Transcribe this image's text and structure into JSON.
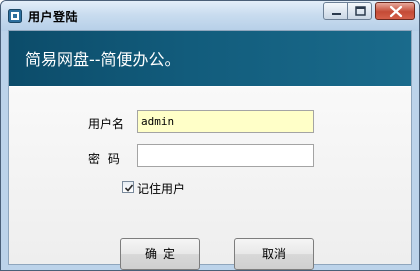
{
  "window": {
    "title": "用户登陆",
    "icon": "app-logo-icon"
  },
  "banner": {
    "text": "简易网盘--简便办公。"
  },
  "form": {
    "username_label": "用户名",
    "username_value": "admin",
    "password_label": "密 码",
    "password_value": "",
    "remember_label": "记住用户",
    "remember_checked": true
  },
  "buttons": {
    "ok_label": "确定",
    "cancel_label": "取消"
  },
  "colors": {
    "banner_bg": "#125c7c",
    "username_field_bg": "#ffffc8",
    "close_button": "#c44b36"
  }
}
